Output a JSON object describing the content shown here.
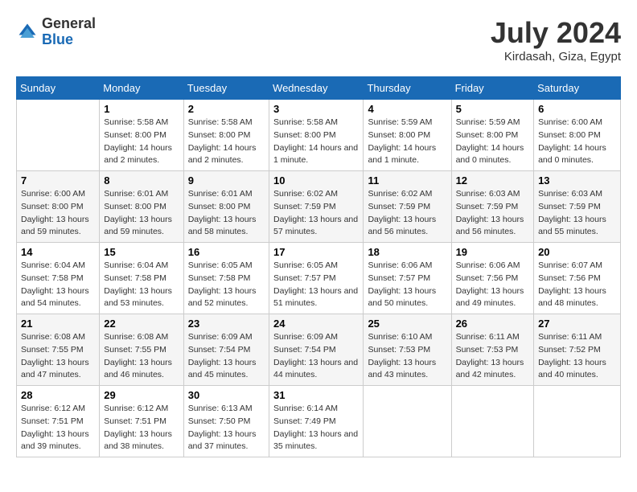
{
  "logo": {
    "general": "General",
    "blue": "Blue"
  },
  "title": "July 2024",
  "subtitle": "Kirdasah, Giza, Egypt",
  "days_of_week": [
    "Sunday",
    "Monday",
    "Tuesday",
    "Wednesday",
    "Thursday",
    "Friday",
    "Saturday"
  ],
  "weeks": [
    [
      {
        "day": "",
        "sunrise": "",
        "sunset": "",
        "daylight": ""
      },
      {
        "day": "1",
        "sunrise": "Sunrise: 5:58 AM",
        "sunset": "Sunset: 8:00 PM",
        "daylight": "Daylight: 14 hours and 2 minutes."
      },
      {
        "day": "2",
        "sunrise": "Sunrise: 5:58 AM",
        "sunset": "Sunset: 8:00 PM",
        "daylight": "Daylight: 14 hours and 2 minutes."
      },
      {
        "day": "3",
        "sunrise": "Sunrise: 5:58 AM",
        "sunset": "Sunset: 8:00 PM",
        "daylight": "Daylight: 14 hours and 1 minute."
      },
      {
        "day": "4",
        "sunrise": "Sunrise: 5:59 AM",
        "sunset": "Sunset: 8:00 PM",
        "daylight": "Daylight: 14 hours and 1 minute."
      },
      {
        "day": "5",
        "sunrise": "Sunrise: 5:59 AM",
        "sunset": "Sunset: 8:00 PM",
        "daylight": "Daylight: 14 hours and 0 minutes."
      },
      {
        "day": "6",
        "sunrise": "Sunrise: 6:00 AM",
        "sunset": "Sunset: 8:00 PM",
        "daylight": "Daylight: 14 hours and 0 minutes."
      }
    ],
    [
      {
        "day": "7",
        "sunrise": "Sunrise: 6:00 AM",
        "sunset": "Sunset: 8:00 PM",
        "daylight": "Daylight: 13 hours and 59 minutes."
      },
      {
        "day": "8",
        "sunrise": "Sunrise: 6:01 AM",
        "sunset": "Sunset: 8:00 PM",
        "daylight": "Daylight: 13 hours and 59 minutes."
      },
      {
        "day": "9",
        "sunrise": "Sunrise: 6:01 AM",
        "sunset": "Sunset: 8:00 PM",
        "daylight": "Daylight: 13 hours and 58 minutes."
      },
      {
        "day": "10",
        "sunrise": "Sunrise: 6:02 AM",
        "sunset": "Sunset: 7:59 PM",
        "daylight": "Daylight: 13 hours and 57 minutes."
      },
      {
        "day": "11",
        "sunrise": "Sunrise: 6:02 AM",
        "sunset": "Sunset: 7:59 PM",
        "daylight": "Daylight: 13 hours and 56 minutes."
      },
      {
        "day": "12",
        "sunrise": "Sunrise: 6:03 AM",
        "sunset": "Sunset: 7:59 PM",
        "daylight": "Daylight: 13 hours and 56 minutes."
      },
      {
        "day": "13",
        "sunrise": "Sunrise: 6:03 AM",
        "sunset": "Sunset: 7:59 PM",
        "daylight": "Daylight: 13 hours and 55 minutes."
      }
    ],
    [
      {
        "day": "14",
        "sunrise": "Sunrise: 6:04 AM",
        "sunset": "Sunset: 7:58 PM",
        "daylight": "Daylight: 13 hours and 54 minutes."
      },
      {
        "day": "15",
        "sunrise": "Sunrise: 6:04 AM",
        "sunset": "Sunset: 7:58 PM",
        "daylight": "Daylight: 13 hours and 53 minutes."
      },
      {
        "day": "16",
        "sunrise": "Sunrise: 6:05 AM",
        "sunset": "Sunset: 7:58 PM",
        "daylight": "Daylight: 13 hours and 52 minutes."
      },
      {
        "day": "17",
        "sunrise": "Sunrise: 6:05 AM",
        "sunset": "Sunset: 7:57 PM",
        "daylight": "Daylight: 13 hours and 51 minutes."
      },
      {
        "day": "18",
        "sunrise": "Sunrise: 6:06 AM",
        "sunset": "Sunset: 7:57 PM",
        "daylight": "Daylight: 13 hours and 50 minutes."
      },
      {
        "day": "19",
        "sunrise": "Sunrise: 6:06 AM",
        "sunset": "Sunset: 7:56 PM",
        "daylight": "Daylight: 13 hours and 49 minutes."
      },
      {
        "day": "20",
        "sunrise": "Sunrise: 6:07 AM",
        "sunset": "Sunset: 7:56 PM",
        "daylight": "Daylight: 13 hours and 48 minutes."
      }
    ],
    [
      {
        "day": "21",
        "sunrise": "Sunrise: 6:08 AM",
        "sunset": "Sunset: 7:55 PM",
        "daylight": "Daylight: 13 hours and 47 minutes."
      },
      {
        "day": "22",
        "sunrise": "Sunrise: 6:08 AM",
        "sunset": "Sunset: 7:55 PM",
        "daylight": "Daylight: 13 hours and 46 minutes."
      },
      {
        "day": "23",
        "sunrise": "Sunrise: 6:09 AM",
        "sunset": "Sunset: 7:54 PM",
        "daylight": "Daylight: 13 hours and 45 minutes."
      },
      {
        "day": "24",
        "sunrise": "Sunrise: 6:09 AM",
        "sunset": "Sunset: 7:54 PM",
        "daylight": "Daylight: 13 hours and 44 minutes."
      },
      {
        "day": "25",
        "sunrise": "Sunrise: 6:10 AM",
        "sunset": "Sunset: 7:53 PM",
        "daylight": "Daylight: 13 hours and 43 minutes."
      },
      {
        "day": "26",
        "sunrise": "Sunrise: 6:11 AM",
        "sunset": "Sunset: 7:53 PM",
        "daylight": "Daylight: 13 hours and 42 minutes."
      },
      {
        "day": "27",
        "sunrise": "Sunrise: 6:11 AM",
        "sunset": "Sunset: 7:52 PM",
        "daylight": "Daylight: 13 hours and 40 minutes."
      }
    ],
    [
      {
        "day": "28",
        "sunrise": "Sunrise: 6:12 AM",
        "sunset": "Sunset: 7:51 PM",
        "daylight": "Daylight: 13 hours and 39 minutes."
      },
      {
        "day": "29",
        "sunrise": "Sunrise: 6:12 AM",
        "sunset": "Sunset: 7:51 PM",
        "daylight": "Daylight: 13 hours and 38 minutes."
      },
      {
        "day": "30",
        "sunrise": "Sunrise: 6:13 AM",
        "sunset": "Sunset: 7:50 PM",
        "daylight": "Daylight: 13 hours and 37 minutes."
      },
      {
        "day": "31",
        "sunrise": "Sunrise: 6:14 AM",
        "sunset": "Sunset: 7:49 PM",
        "daylight": "Daylight: 13 hours and 35 minutes."
      },
      {
        "day": "",
        "sunrise": "",
        "sunset": "",
        "daylight": ""
      },
      {
        "day": "",
        "sunrise": "",
        "sunset": "",
        "daylight": ""
      },
      {
        "day": "",
        "sunrise": "",
        "sunset": "",
        "daylight": ""
      }
    ]
  ]
}
